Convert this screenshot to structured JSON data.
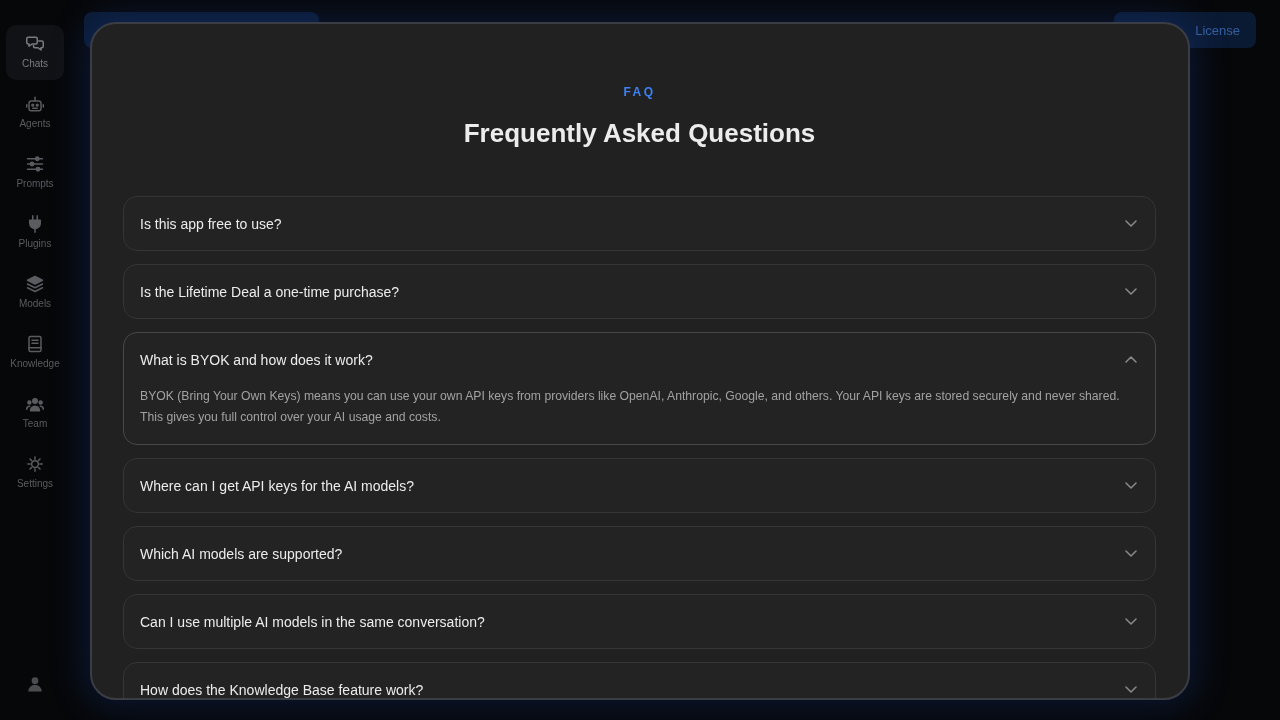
{
  "sidebar": {
    "items": [
      {
        "label": "Chats",
        "selected": true
      },
      {
        "label": "Agents",
        "selected": false
      },
      {
        "label": "Prompts",
        "selected": false
      },
      {
        "label": "Plugins",
        "selected": false
      },
      {
        "label": "Models",
        "selected": false
      },
      {
        "label": "Knowledge",
        "selected": false
      },
      {
        "label": "Team",
        "selected": false
      },
      {
        "label": "Settings",
        "selected": false
      }
    ]
  },
  "top_bar": {
    "license_button": {
      "label": "License"
    }
  },
  "faq": {
    "eyebrow": "FAQ",
    "title": "Frequently Asked Questions",
    "items": [
      {
        "question": "Is this app free to use?",
        "expanded": false
      },
      {
        "question": "Is the Lifetime Deal a one-time purchase?",
        "expanded": false
      },
      {
        "question": "What is BYOK and how does it work?",
        "expanded": true,
        "answer": "BYOK (Bring Your Own Keys) means you can use your own API keys from providers like OpenAI, Anthropic, Google, and others. Your API keys are stored securely and never shared. This gives you full control over your AI usage and costs."
      },
      {
        "question": "Where can I get API keys for the AI models?",
        "expanded": false
      },
      {
        "question": "Which AI models are supported?",
        "expanded": false
      },
      {
        "question": "Can I use multiple AI models in the same conversation?",
        "expanded": false
      },
      {
        "question": "How does the Knowledge Base feature work?",
        "expanded": false
      }
    ]
  }
}
